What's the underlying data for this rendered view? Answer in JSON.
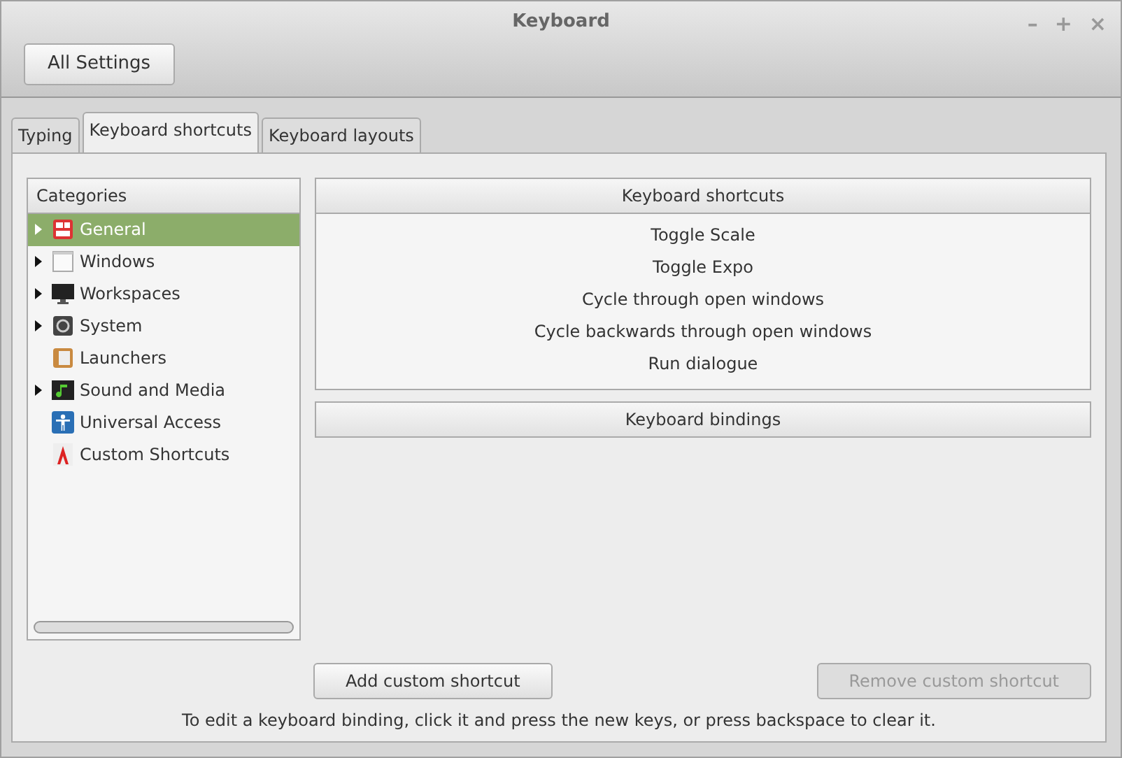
{
  "window": {
    "title": "Keyboard",
    "controls": [
      "–",
      "+",
      "×"
    ]
  },
  "toolbar": {
    "button": "All Settings"
  },
  "tabs": [
    {
      "label": "Typing",
      "selected": false
    },
    {
      "label": "Keyboard shortcuts",
      "selected": true
    },
    {
      "label": "Keyboard layouts",
      "selected": false
    }
  ],
  "categories": {
    "heading": "Categories",
    "items": [
      {
        "label": "General",
        "kind": "general",
        "expandable": true,
        "selected": true
      },
      {
        "label": "Windows",
        "kind": "windows",
        "expandable": true,
        "selected": false
      },
      {
        "label": "Workspaces",
        "kind": "workspaces",
        "expandable": true,
        "selected": false
      },
      {
        "label": "System",
        "kind": "system",
        "expandable": true,
        "selected": false
      },
      {
        "label": "Launchers",
        "kind": "launchers",
        "expandable": false,
        "selected": false
      },
      {
        "label": "Sound and Media",
        "kind": "media",
        "expandable": true,
        "selected": false
      },
      {
        "label": "Universal Access",
        "kind": "access",
        "expandable": false,
        "selected": false
      },
      {
        "label": "Custom Shortcuts",
        "kind": "custom",
        "expandable": false,
        "selected": false
      }
    ]
  },
  "shortcuts": {
    "heading": "Keyboard shortcuts",
    "items": [
      "Toggle Scale",
      "Toggle Expo",
      "Cycle through open windows",
      "Cycle backwards through open windows",
      "Run dialogue"
    ]
  },
  "bindings": {
    "heading": "Keyboard bindings"
  },
  "buttons": [
    {
      "label": "Add custom shortcut",
      "disabled": false
    },
    {
      "label": "Remove custom shortcut",
      "disabled": true
    }
  ],
  "hint": "To edit a keyboard binding, click it and press the new keys, or press backspace to clear it."
}
